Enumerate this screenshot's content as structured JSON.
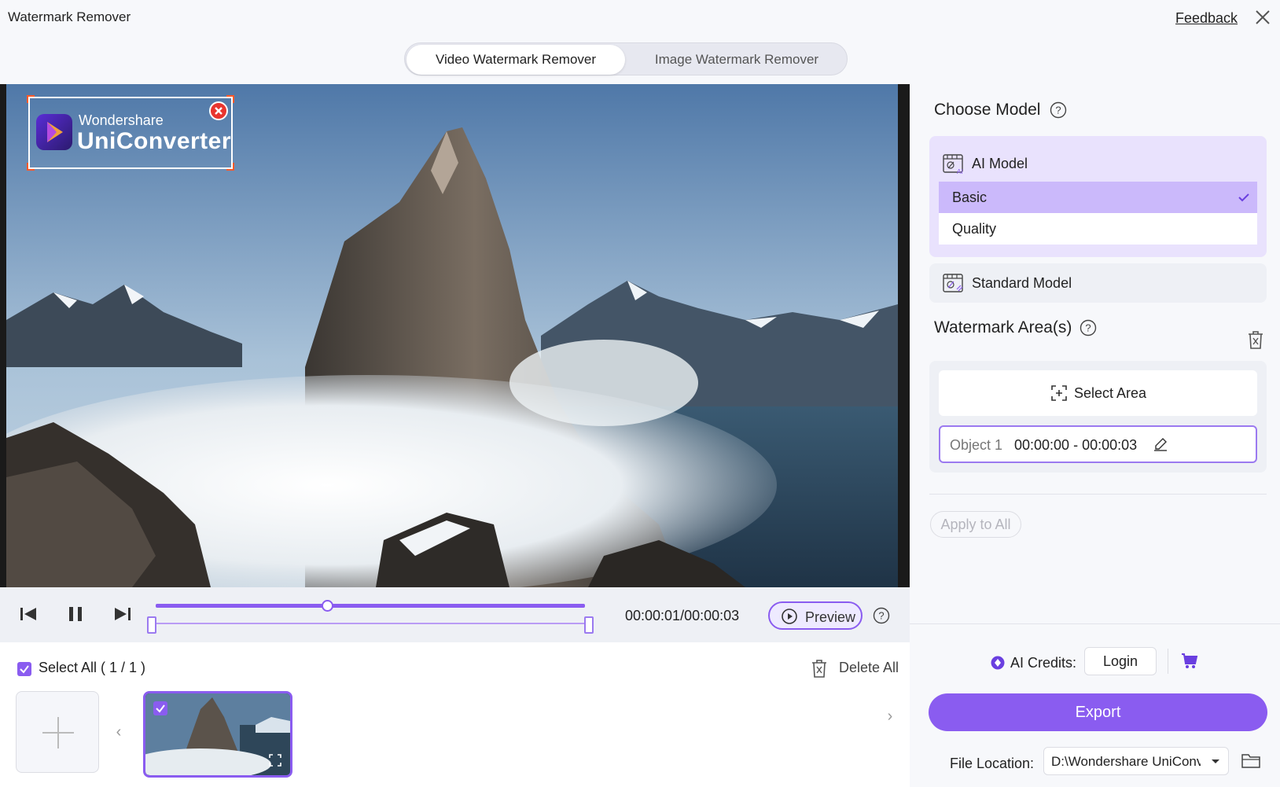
{
  "window": {
    "title": "Watermark Remover",
    "feedback_label": "Feedback",
    "close_icon": "close-icon"
  },
  "mode_tabs": [
    {
      "label": "Video Watermark Remover",
      "active": true
    },
    {
      "label": "Image Watermark Remover",
      "active": false
    }
  ],
  "preview": {
    "watermark_brand": "Wondershare",
    "watermark_product": "UniConverter"
  },
  "player": {
    "time": "00:00:01/00:00:03",
    "progress_fraction": 0.4,
    "preview_label": "Preview"
  },
  "files": {
    "select_all_label": "Select All ( 1 / 1 )",
    "delete_all_label": "Delete All"
  },
  "side": {
    "choose_model_heading": "Choose Model",
    "ai_model_label": "AI Model",
    "ai_options": [
      {
        "label": "Basic",
        "selected": true
      },
      {
        "label": "Quality",
        "selected": false
      }
    ],
    "standard_model_label": "Standard Model",
    "watermark_areas_heading": "Watermark Area(s)",
    "select_area_label": "Select Area",
    "objects": [
      {
        "name": "Object 1",
        "time": "00:00:00 - 00:00:03"
      }
    ],
    "apply_all_label": "Apply to All",
    "credits_label": "AI Credits:",
    "login_label": "Login",
    "export_label": "Export",
    "file_location_label": "File Location:",
    "file_location_value": "D:\\Wondershare UniConverter"
  },
  "colors": {
    "accent": "#8a5cf0",
    "accent_light": "#e9e2fd",
    "accent_selected": "#cbb9fb",
    "watermark_remove": "#e8352f",
    "corner_handle": "#ff5a2a"
  }
}
